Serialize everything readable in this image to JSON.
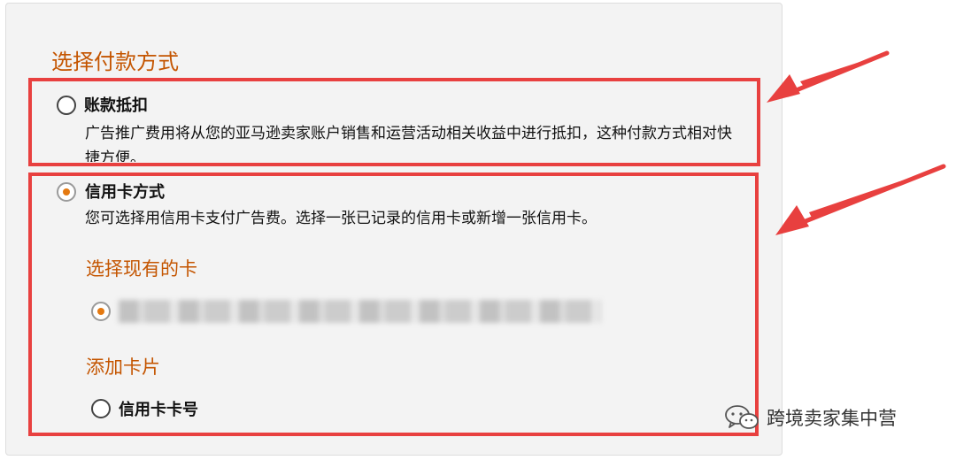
{
  "page": {
    "section_title": "选择付款方式"
  },
  "options": [
    {
      "label": "账款抵扣",
      "description": "广告推广费用将从您的亚马逊卖家账户销售和运营活动相关收益中进行抵扣，这种付款方式相对快捷方便。",
      "selected": false
    },
    {
      "label": "信用卡方式",
      "description": "您可选择用信用卡支付广告费。选择一张已记录的信用卡或新增一张信用卡。",
      "selected": true
    }
  ],
  "existing_cards": {
    "title": "选择现有的卡",
    "card_selected": true
  },
  "add_card": {
    "title": "添加卡片",
    "option_label": "信用卡卡号",
    "selected": false
  },
  "watermark": {
    "text": "跨境卖家集中营"
  },
  "colors": {
    "accent_orange": "#c45500",
    "radio_dot": "#e47911",
    "highlight_red": "#e8403f"
  }
}
